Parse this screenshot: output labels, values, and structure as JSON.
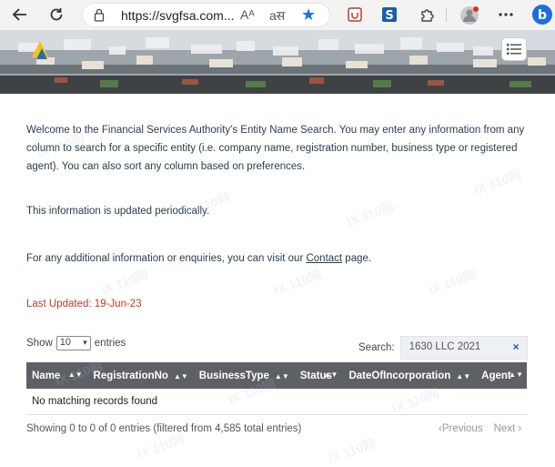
{
  "browser": {
    "url": "https://svgfsa.com...",
    "read_aloud_glyph": "Aᴬ",
    "translate_glyph": "aस"
  },
  "intro": {
    "line1": "Welcome to the Financial Services Authority's Entity Name Search. You may enter any information from any column to search for a specific entity (i.e. company name, registration number, business type or registered agent). You can also sort any column based on preferences.",
    "periodic": "This information is updated periodically.",
    "contact_prefix": "For any additional information or enquiries, you can visit our ",
    "contact_link": "Contact",
    "contact_suffix": " page."
  },
  "last_updated": "Last Updated:  19-Jun-23",
  "controls": {
    "show_label": "Show",
    "show_value": "10",
    "entries_label": "entries",
    "search_label": "Search:",
    "search_value": "1630 LLC 2021",
    "clear_symbol": "×"
  },
  "table": {
    "columns": [
      "Name",
      "RegistrationNo",
      "BusinessType",
      "Status",
      "DateOfIncorporation",
      "Agent"
    ],
    "empty_message": "No matching records found"
  },
  "footer": {
    "info": "Showing 0 to 0 of 0 entries (filtered from 4,585 total entries)",
    "previous": "‹Previous",
    "next": "Next ›"
  },
  "watermark": "IX 110网",
  "colors": {
    "accent_blue": "#1a73e8",
    "updated_red": "#c0392b",
    "table_header": "#5d6166"
  }
}
